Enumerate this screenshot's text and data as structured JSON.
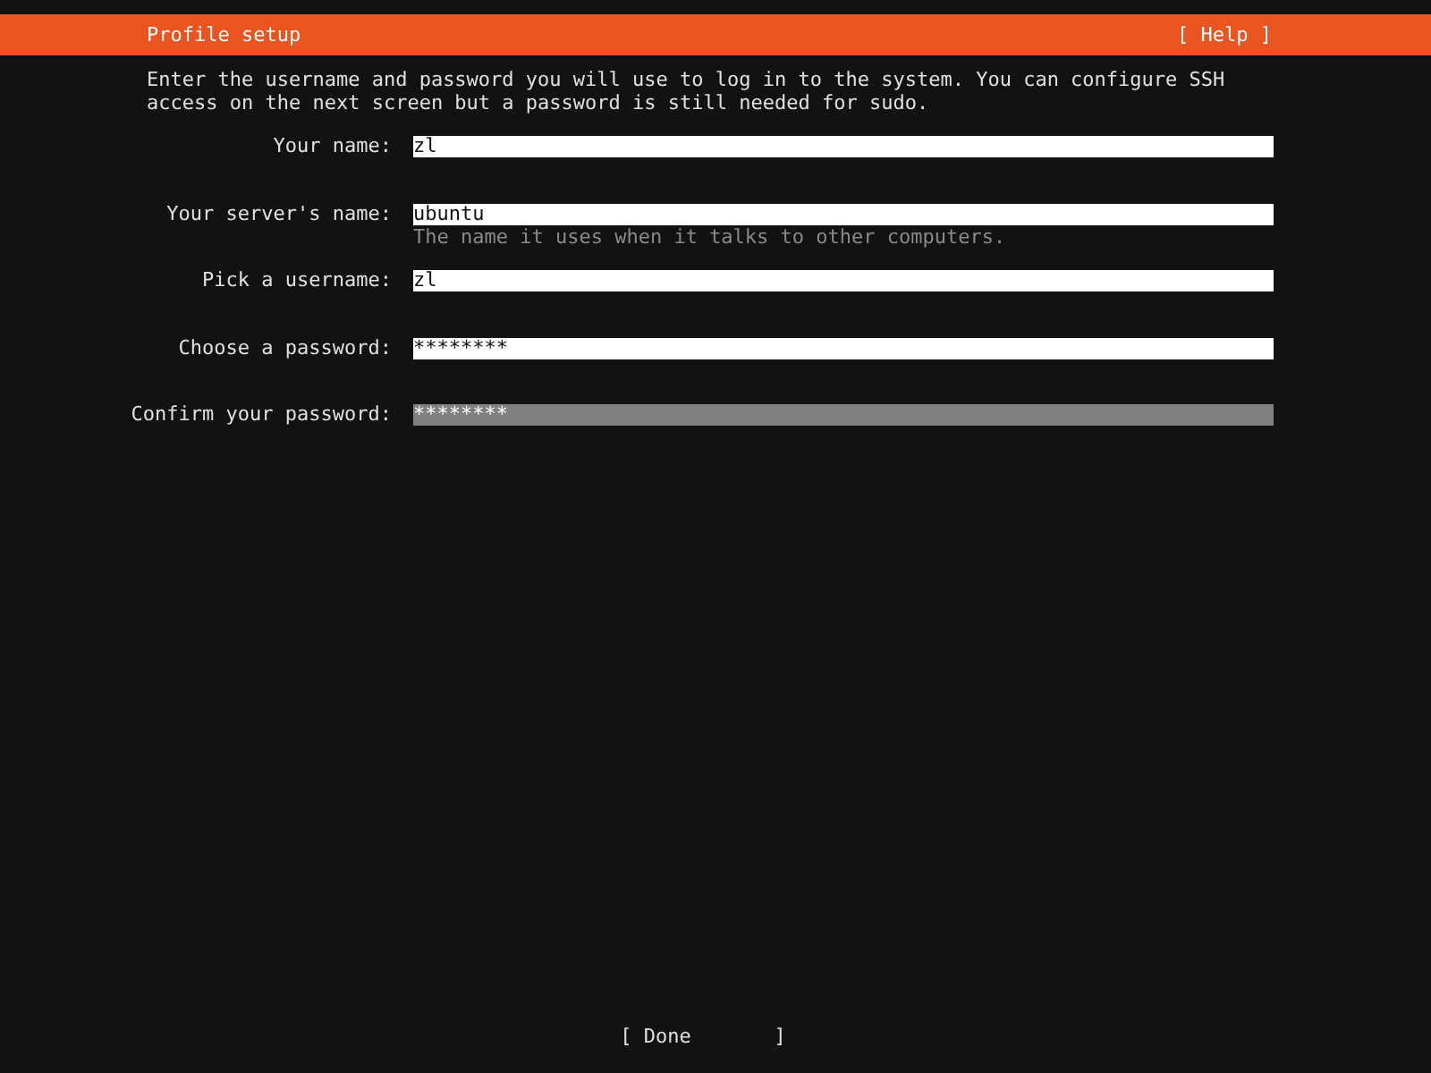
{
  "header": {
    "title": "Profile setup",
    "help": "[ Help ]"
  },
  "intro": "Enter the username and password you will use to log in to the system. You can configure SSH access on the next screen but a password is still needed for sudo.",
  "fields": [
    {
      "label": "Your name:",
      "value": "zl",
      "focused": false
    },
    {
      "label": "Your server's name:",
      "value": "ubuntu",
      "hint": "The name it uses when it talks to other computers.",
      "focused": false
    },
    {
      "label": "Pick a username:",
      "value": "zl",
      "focused": false
    },
    {
      "label": "Choose a password:",
      "value": "********",
      "focused": false
    },
    {
      "label": "Confirm your password:",
      "value": "********",
      "focused": true
    }
  ],
  "done_button": "[ Done       ]"
}
